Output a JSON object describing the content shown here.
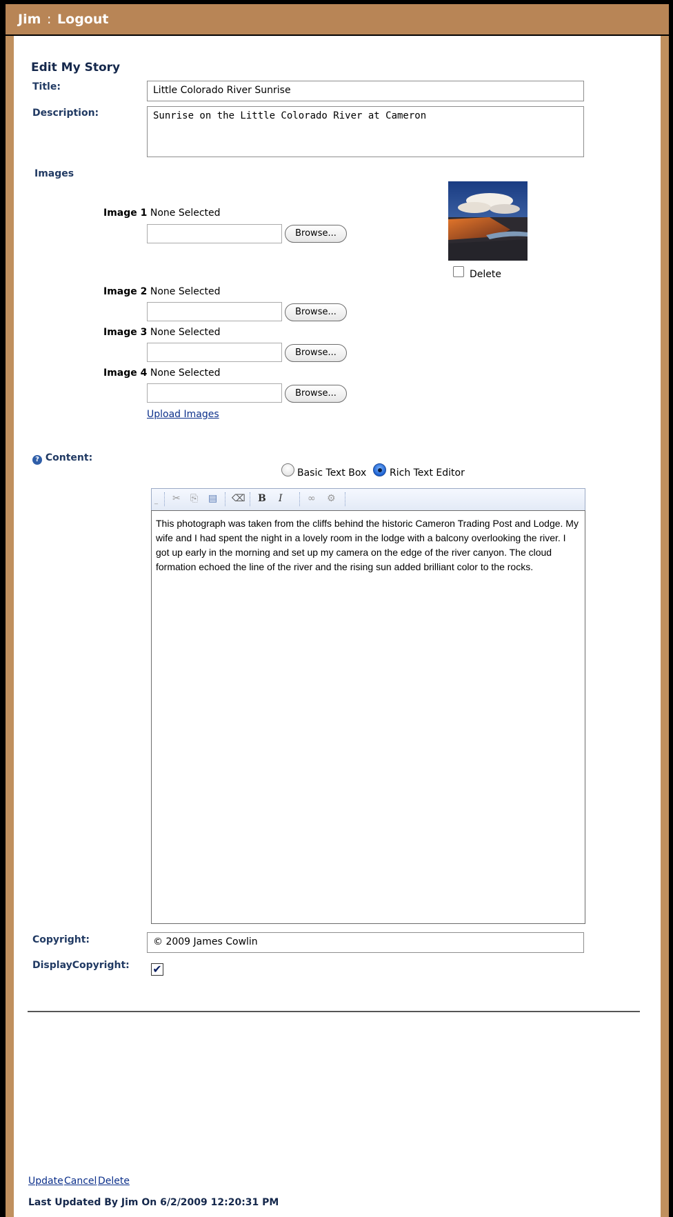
{
  "header": {
    "user": "Jim",
    "separator": ":",
    "logout_label": "Logout"
  },
  "page": {
    "heading": "Edit My Story"
  },
  "form": {
    "title_label": "Title:",
    "title_value": "Little Colorado River Sunrise",
    "description_label": "Description:",
    "description_value": "Sunrise on the Little Colorado River at Cameron",
    "images_label": "Images",
    "images": [
      {
        "label": "Image 1",
        "status": "None Selected",
        "browse_label": "Browse..."
      },
      {
        "label": "Image 2",
        "status": "None Selected",
        "browse_label": "Browse..."
      },
      {
        "label": "Image 3",
        "status": "None Selected",
        "browse_label": "Browse..."
      },
      {
        "label": "Image 4",
        "status": "None Selected",
        "browse_label": "Browse..."
      }
    ],
    "thumbnail_delete_label": "Delete",
    "upload_images_label": "Upload Images",
    "content_label": "Content:",
    "editor_modes": {
      "basic_label": "Basic Text Box",
      "rich_label": "Rich Text Editor",
      "selected": "Rich Text Editor"
    },
    "toolbar": {
      "bold": "B",
      "italic": "I"
    },
    "content_text": "This photograph was taken from the cliffs behind the historic Cameron Trading Post and Lodge. My wife and I had spent the night in a lovely room in the lodge with a balcony overlooking the river. I got up early in the morning and set up my camera on the edge of the river canyon. The cloud formation echoed the line of the river and the rising sun added brilliant color to the rocks.",
    "copyright_label": "Copyright:",
    "copyright_value": "© 2009 James Cowlin",
    "display_copyright_label": "DisplayCopyright:",
    "display_copyright_checked": true
  },
  "actions": {
    "update_label": "Update",
    "cancel_label": "Cancel",
    "delete_label": "Delete"
  },
  "footer": {
    "last_updated": "Last Updated By Jim On 6/2/2009 12:20:31 PM"
  },
  "colors": {
    "header_bg": "#b88556",
    "border_tan": "#c0905e",
    "label_color": "#213a63",
    "link_color": "#0b2f8a"
  }
}
